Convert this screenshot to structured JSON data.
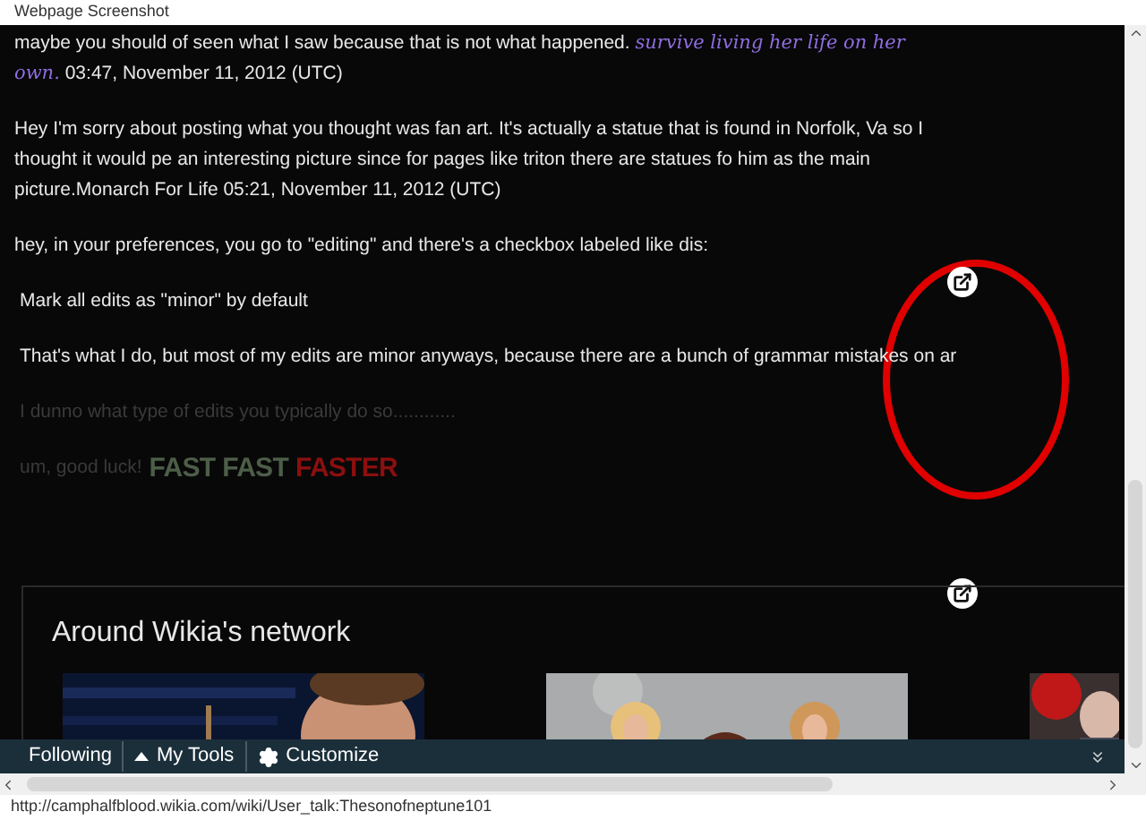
{
  "window": {
    "title": "Webpage Screenshot"
  },
  "comments": [
    {
      "kind": "signed",
      "text": "maybe you should of seen what I saw because that is not what happened.",
      "signature": "survive living her life on her own.",
      "timestamp": "03:47, November 11, 2012 (UTC)"
    },
    {
      "kind": "plain",
      "text": "Hey I'm sorry about posting what you thought was fan art. It's actually a statue that is found in Norfolk, Va so I thought it would pe an interesting picture since for pages like triton there are statues fo him as the main picture.Monarch For Life 05:21, November 11, 2012 (UTC)"
    },
    {
      "kind": "plain",
      "text": "hey, in your preferences, you go to \"editing\" and there's a checkbox labeled like dis:"
    },
    {
      "kind": "indented",
      "text": "Mark all edits as \"minor\" by default"
    },
    {
      "kind": "indented",
      "text": "That's what I do, but most of my edits are minor anyways, because there are a bunch of grammar mistakes on ar"
    },
    {
      "kind": "faded",
      "text": "I dunno what type of edits you typically do so............"
    },
    {
      "kind": "faded",
      "text": "um, good luck!",
      "badge": [
        {
          "text": "FAST",
          "color": "#4d5e48"
        },
        {
          "text": "FAST",
          "color": "#4d5e48"
        },
        {
          "text": "FASTER",
          "color": "#8b0f0f"
        }
      ]
    }
  ],
  "network": {
    "title": "Around Wikia's network"
  },
  "toolbar": {
    "items": [
      {
        "label": "Following"
      },
      {
        "label": "My Tools"
      },
      {
        "label": "Customize"
      }
    ]
  },
  "status_bar": {
    "text": "http://camphalfblood.wikia.com/wiki/User_talk:Thesonofneptune101"
  }
}
